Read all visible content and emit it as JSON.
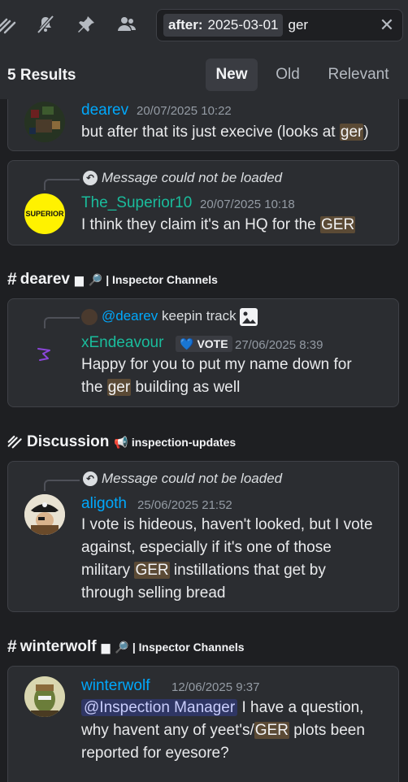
{
  "search": {
    "filter_key": "after:",
    "filter_value": "2025-03-01",
    "query": "ger"
  },
  "results": {
    "count_label": "5 Results",
    "sort_new": "New",
    "sort_old": "Old",
    "sort_relevant": "Relevant"
  },
  "messages": [
    {
      "author": "dearev",
      "timestamp": "20/07/2025 10:22",
      "text_before": "but after that its just execive (looks at ",
      "highlight": "ger",
      "text_after": ")"
    },
    {
      "reply_status": "Message could not be loaded",
      "avatar_text": "SUPERIOR",
      "author": "The_Superior10",
      "timestamp": "20/07/2025 10:18",
      "text_before": "I think they claim it's an HQ for the ",
      "highlight": "GER",
      "text_after": ""
    },
    {
      "reply_author": "@dearev",
      "reply_text": "keepin track",
      "author": "xEndeavour",
      "badge": "VOTE",
      "timestamp": "27/06/2025 8:39",
      "text_line1": "Happy for you to put my name down for",
      "text_before2": "the ",
      "highlight": "ger",
      "text_after2": " building as well"
    },
    {
      "reply_status": "Message could not be loaded",
      "author": "aligoth",
      "timestamp": "25/06/2025 21:52",
      "line1": "I vote is hideous, haven't looked, but I vote",
      "line2": "against, especially if it's one of those",
      "line3_before": "military ",
      "highlight": "GER",
      "line3_after": " instillations that get by",
      "line4": "through selling bread"
    },
    {
      "author": "winterwolf",
      "timestamp": "12/06/2025 9:37",
      "mention": "@Inspection Manager",
      "line1_after": " I have a question,",
      "line2_before": "why havent any of yeet's/",
      "highlight": "GER",
      "line2_after": " plots been",
      "line3": "reported for eyesore?"
    }
  ],
  "channels": [
    {
      "name": "dearev",
      "sub": "| Inspector Channels"
    },
    {
      "name": "Discussion",
      "sub": "inspection-updates"
    },
    {
      "name": "winterwolf",
      "sub": "| Inspector Channels"
    }
  ],
  "colors": {
    "accent_blue": "#00a8fc",
    "accent_teal": "#1abc9c",
    "highlight_bg": "#5b4a35",
    "mention_bg": "#2f3664"
  }
}
